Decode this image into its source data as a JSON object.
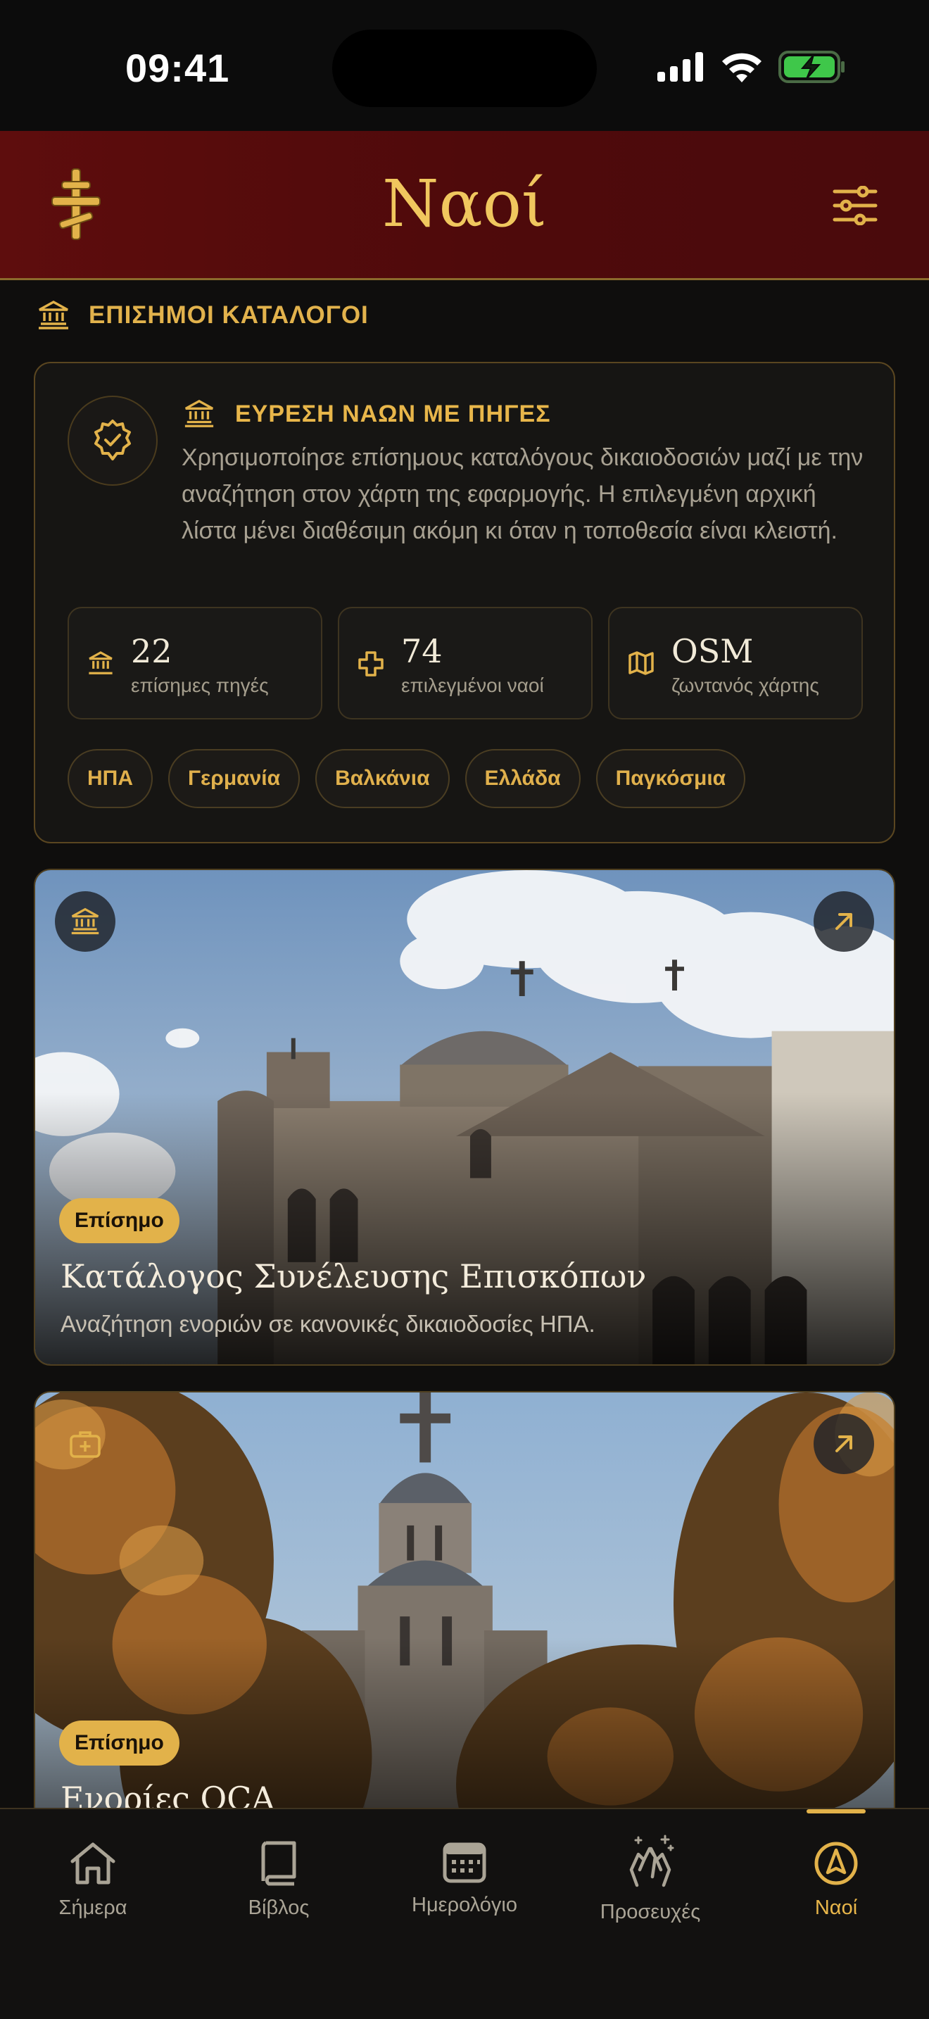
{
  "status_bar": {
    "time": "09:41"
  },
  "header": {
    "title": "Ναοί"
  },
  "section": {
    "label": "ΕΠΙΣΗΜΟΙ ΚΑΤΑΛΟΓΟΙ"
  },
  "info_card": {
    "title": "ΕΥΡΕΣΗ ΝΑΩΝ ΜΕ ΠΗΓΕΣ",
    "description": "Χρησιμοποίησε επίσημους καταλόγους δικαιοδοσιών μαζί με την αναζήτηση στον χάρτη της εφαρμογής. Η επιλεγμένη αρχική λίστα μένει διαθέσιμη ακόμη κι όταν η τοποθεσία είναι κλειστή.",
    "stats": [
      {
        "value": "22",
        "label": "επίσημες πηγές",
        "icon": "bank-icon"
      },
      {
        "value": "74",
        "label": "επιλεγμένοι ναοί",
        "icon": "cross-icon"
      },
      {
        "value": "OSM",
        "label": "ζωντανός χάρτης",
        "icon": "map-icon"
      }
    ],
    "chips": [
      "ΗΠΑ",
      "Γερμανία",
      "Βαλκάνια",
      "Ελλάδα",
      "Παγκόσμια"
    ]
  },
  "cards": [
    {
      "badge": "Επίσημο",
      "title": "Κατάλογος Συνέλευσης Επισκόπων",
      "subtitle": "Αναζήτηση ενοριών σε κανονικές δικαιοδοσίες ΗΠΑ.",
      "icon": "bank-icon"
    },
    {
      "badge": "Επίσημο",
      "title": "Ενορίες OCA",
      "subtitle": "",
      "icon": "first-aid-kit-icon"
    }
  ],
  "tabs": [
    {
      "label": "Σήμερα",
      "icon": "home-icon",
      "active": false
    },
    {
      "label": "Βίβλος",
      "icon": "book-icon",
      "active": false
    },
    {
      "label": "Ημερολόγιο",
      "icon": "calendar-icon",
      "active": false
    },
    {
      "label": "Προσευχές",
      "icon": "praying-hands-icon",
      "active": false
    },
    {
      "label": "Ναοί",
      "icon": "compass-icon",
      "active": true
    }
  ],
  "colors": {
    "accent": "#e2b24a",
    "header_bg": "#5e0d0d",
    "background": "#0f0e0d"
  }
}
